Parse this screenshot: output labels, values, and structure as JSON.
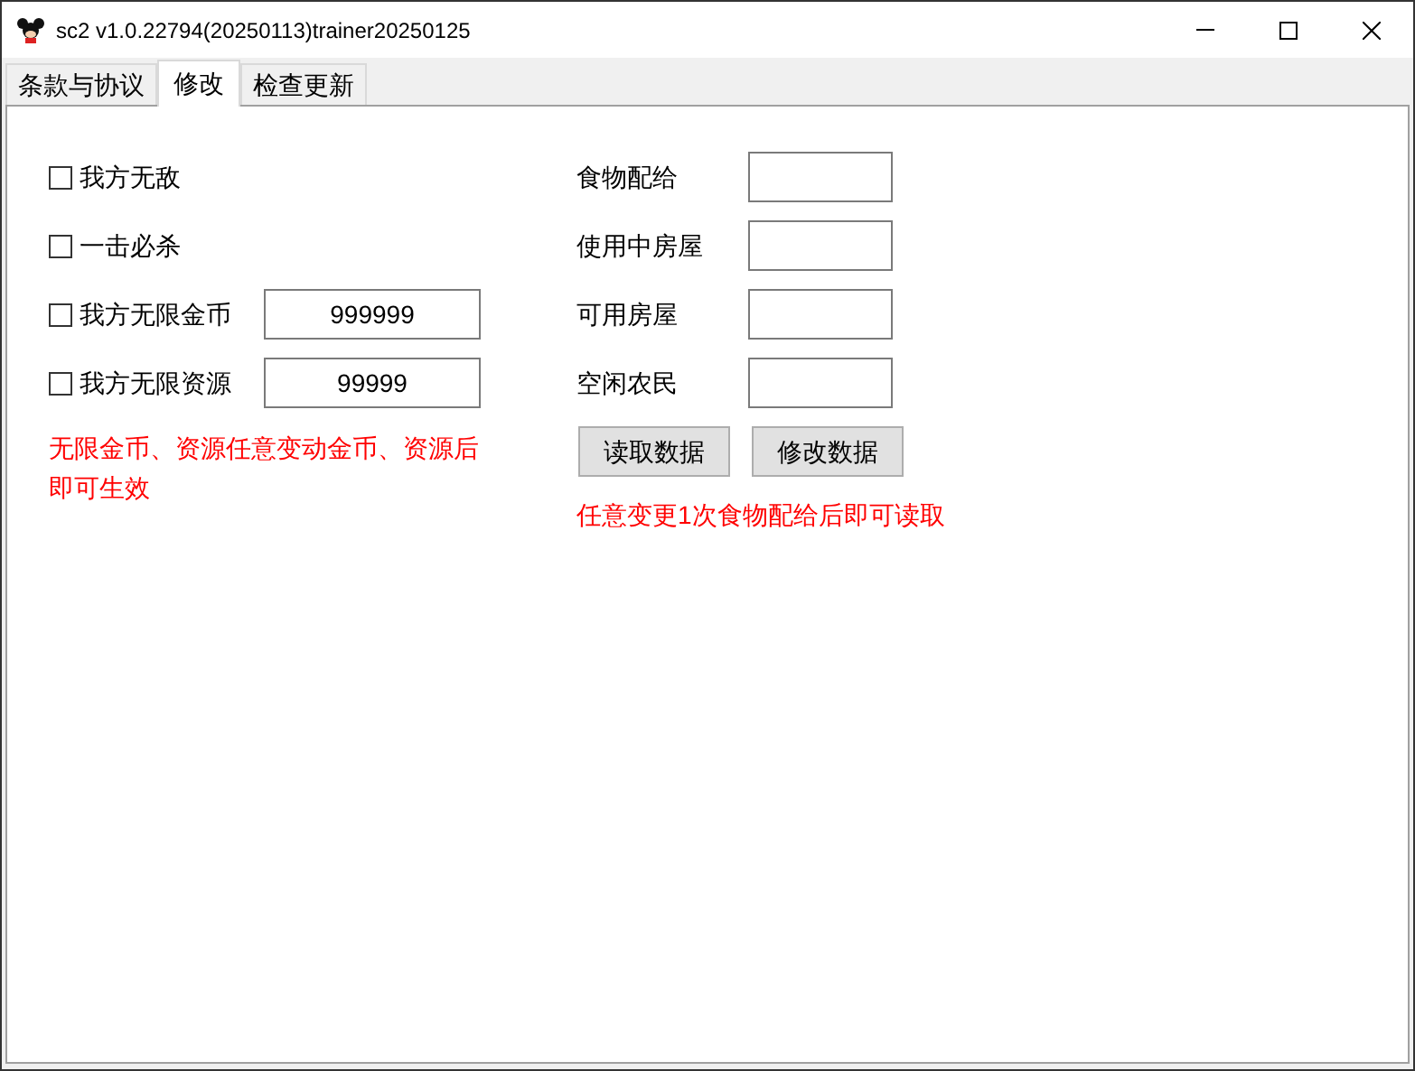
{
  "window": {
    "title": "sc2 v1.0.22794(20250113)trainer20250125"
  },
  "tabs": [
    {
      "label": "条款与协议",
      "selected": false
    },
    {
      "label": "修改",
      "selected": true
    },
    {
      "label": "检查更新",
      "selected": false
    }
  ],
  "options": [
    {
      "label": "我方无敌",
      "checked": false
    },
    {
      "label": "一击必杀",
      "checked": false
    },
    {
      "label": "我方无限金币",
      "checked": false,
      "value": "999999"
    },
    {
      "label": "我方无限资源",
      "checked": false,
      "value": "99999"
    }
  ],
  "left_note": "无限金币、资源任意变动金币、资源后即可生效",
  "fields": [
    {
      "label": "食物配给"
    },
    {
      "label": "使用中房屋"
    },
    {
      "label": "可用房屋"
    },
    {
      "label": "空闲农民"
    }
  ],
  "buttons": [
    "读取数据",
    "修改数据"
  ],
  "right_note": "任意变更1次食物配给后即可读取"
}
